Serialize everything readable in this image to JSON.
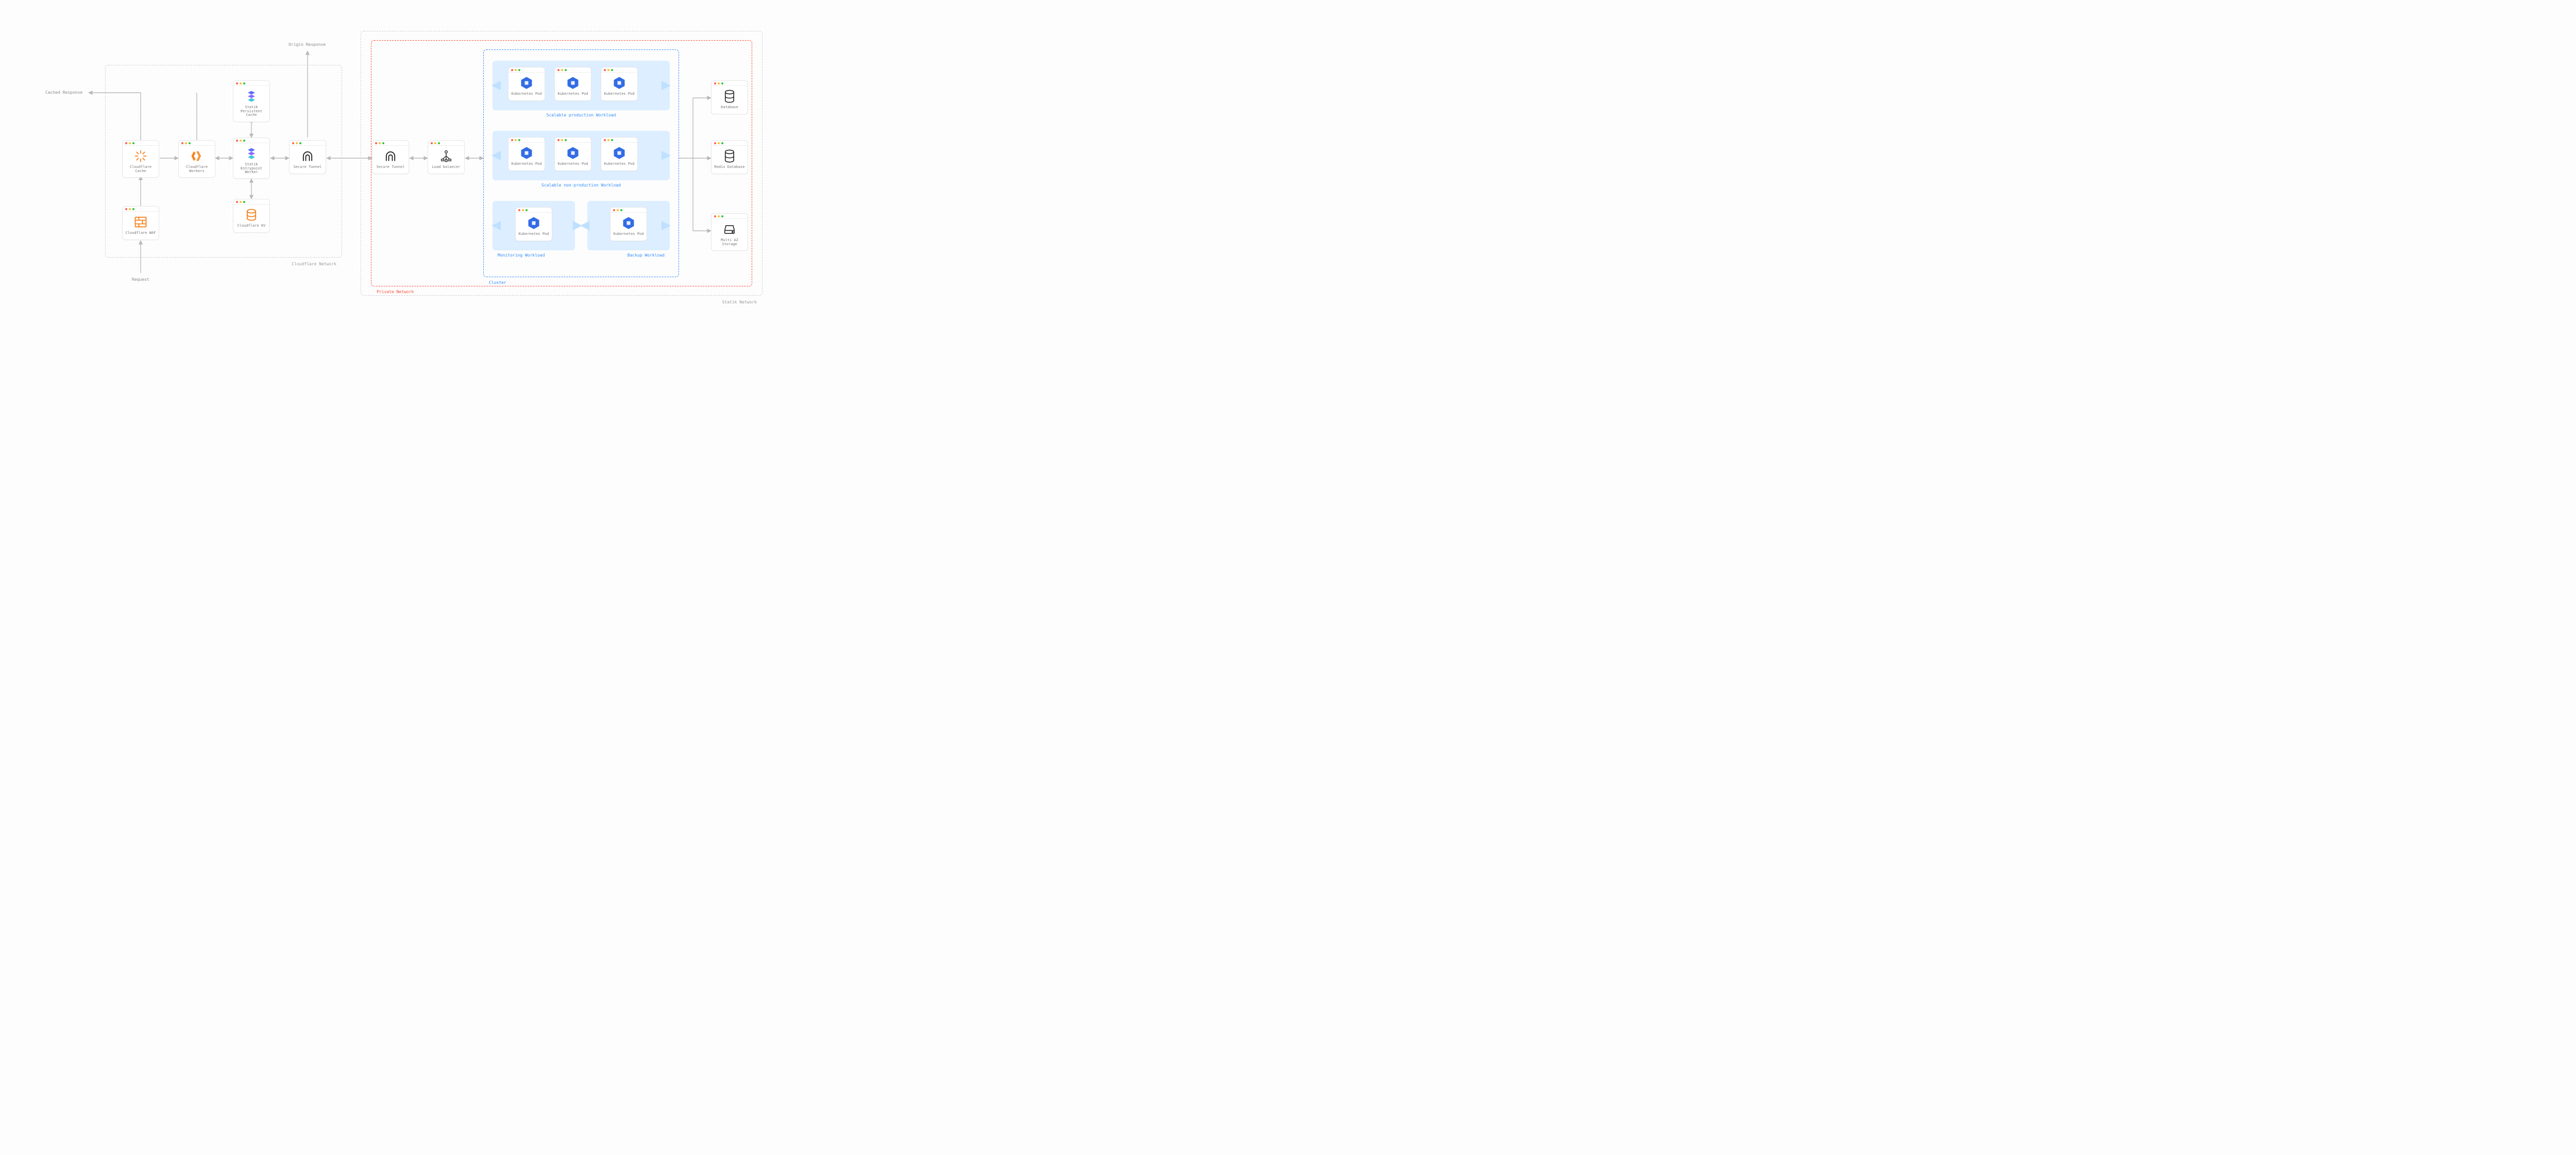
{
  "labels": {
    "request": "Request",
    "cached_response": "Cached Response",
    "origin_response": "Origin Response"
  },
  "regions": {
    "cloudflare": "Cloudflare Network",
    "statik": "Statik Network",
    "private": "Private Network",
    "cluster": "Cluster"
  },
  "nodes": {
    "waf": "Cloudflare WAF",
    "cache": "Cloudflare Cache",
    "workers": "Cloudflare Workers",
    "entry": "Statik Entrypoint Worker",
    "pcache": "Statik Persistent Cache",
    "kv": "Cloudflare KV",
    "tunnel1": "Secure Tunnel",
    "tunnel2": "Secure Tunnel",
    "lb": "Load balancer",
    "pod": "Kubernetes Pod",
    "db": "Database",
    "redis": "Redis Database",
    "storage": "Multi AZ Storage"
  },
  "workloads": {
    "prod": "Scalable production Workload",
    "nonprod": "Scalable non-production Workload",
    "monitor": "Monitoring Workload",
    "backup": "Backup Workload"
  },
  "colors": {
    "cf_orange": "#f6821f",
    "statik_blue": "#4b5cff",
    "k8s_blue": "#326ce5",
    "red": "#ff4d3a",
    "blue": "#2f8cff",
    "grey": "#b9b9b9"
  }
}
